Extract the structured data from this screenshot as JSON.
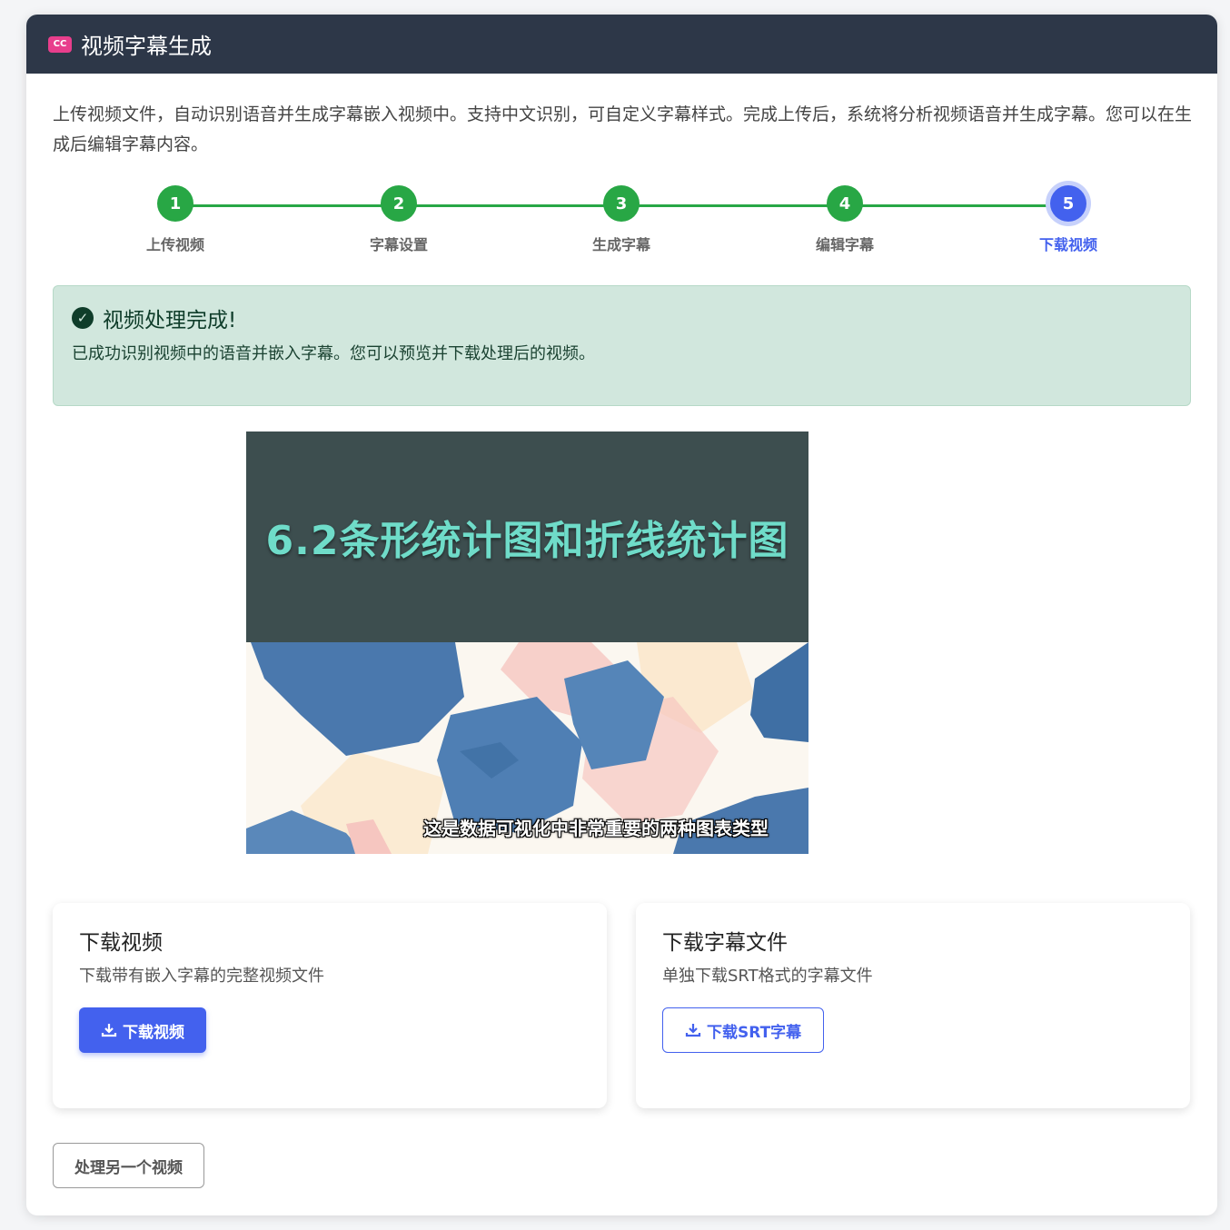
{
  "header": {
    "icon_text": "CC",
    "title": "视频字幕生成"
  },
  "intro": "上传视频文件，自动识别语音并生成字幕嵌入视频中。支持中文识别，可自定义字幕样式。完成上传后，系统将分析视频语音并生成字幕。您可以在生成后编辑字幕内容。",
  "stepper": {
    "steps": [
      {
        "number": "1",
        "label": "上传视频"
      },
      {
        "number": "2",
        "label": "字幕设置"
      },
      {
        "number": "3",
        "label": "生成字幕"
      },
      {
        "number": "4",
        "label": "编辑字幕"
      },
      {
        "number": "5",
        "label": "下载视频"
      }
    ],
    "active": 5
  },
  "alert": {
    "title": "视频处理完成!",
    "text": "已成功识别视频中的语音并嵌入字幕。您可以预览并下载处理后的视频。"
  },
  "video": {
    "title": "6.2条形统计图和折线统计图",
    "subtitle": "这是数据可视化中非常重要的两种图表类型"
  },
  "download_video": {
    "title": "下载视频",
    "desc": "下载带有嵌入字幕的完整视频文件",
    "button": "下载视频"
  },
  "download_srt": {
    "title": "下载字幕文件",
    "desc": "单独下载SRT格式的字幕文件",
    "button": "下载SRT字幕"
  },
  "process_another": "处理另一个视频",
  "colors": {
    "header_bg": "#2d3748",
    "accent": "#4361ee",
    "success": "#28a745",
    "alert_bg": "#d1e7dd",
    "badge": "#e83e8c"
  }
}
